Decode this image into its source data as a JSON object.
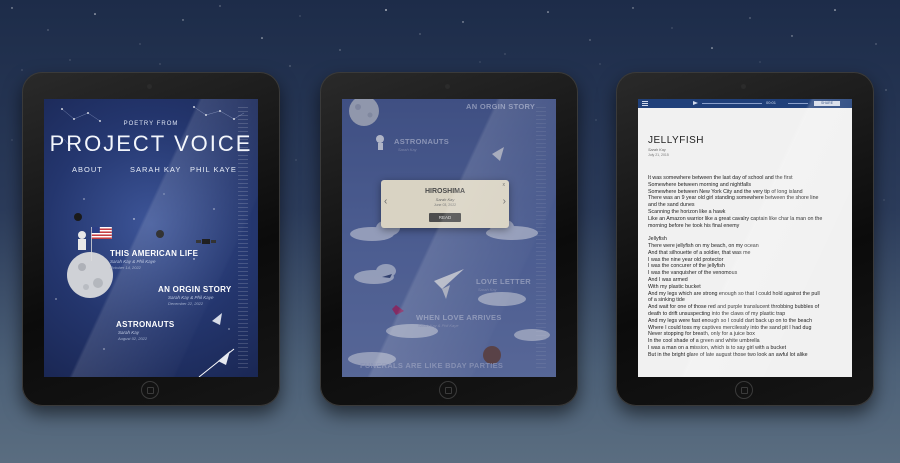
{
  "screen1": {
    "eyebrow": "POETRY FROM",
    "title": "PROJECT VOICE",
    "nav": [
      "ABOUT",
      "SARAH KAY",
      "PHIL KAYE"
    ],
    "poems": [
      {
        "title": "THIS AMERICAN LIFE",
        "authors": "Sarah Kay & Phil Kaye",
        "date": "October 14, 2022"
      },
      {
        "title": "AN ORGIN STORY",
        "authors": "Sarah Kay & Phil Kaye",
        "date": "December 22, 2022"
      },
      {
        "title": "ASTRONAUTS",
        "authors": "Sarah Kay",
        "date": "August 02, 2022"
      }
    ]
  },
  "screen2": {
    "items": [
      {
        "title": "AN ORGIN STORY",
        "sub": "Sarah Kay & Phil Kaye"
      },
      {
        "title": "ASTRONAUTS",
        "sub": "Sarah Kay"
      },
      {
        "title": "LOVE LETTER",
        "sub": "Sarah Kay"
      },
      {
        "title": "WHEN LOVE ARRIVES",
        "sub": "Sarah Kay & Phil Kaye"
      },
      {
        "title": "FUNERALS ARE LIKE BDAY PARTIES",
        "sub": ""
      }
    ],
    "modal": {
      "title": "HIROSHIMA",
      "author": "Sarah Kay",
      "date": "June 03, 2022",
      "button": "READ",
      "close": "x"
    }
  },
  "screen3": {
    "player": {
      "time": "00:01",
      "share": "SHARE"
    },
    "title": "JELLYFISH",
    "author": "Sarah Kay",
    "date": "July 21, 2015",
    "lines": [
      "It was somewhere between the last day of school and the first",
      "Somewhere between morning and nightfalls",
      "Somewhere between New York City and the very tip of long island",
      "There was an 9 year old girl standing somewhere between the shore line",
      "and the sand dunes",
      "Scanning the horizon like a hawk",
      "Like an Amazon warrior like a great cavalry captain like char la man on the",
      "morning before he took his final enemy",
      "",
      "Jellyfish",
      "There were jellyfish on my beach, on my ocean",
      "And that silhouette of a soldier, that was me",
      "I was the nine year old protector",
      "I was the concurer of the jellyfish",
      "I was the vanquisher of the venomous",
      "And I was armed",
      "With my plastic bucket",
      "And my legs which are strong enough so that I could hold against the pull",
      "of a sinking tide",
      "And wait for one of those red and purple translucent throbbing bubbles of",
      "death to drift unsuspecting into the claws of my plastic trap",
      "And my legs were fast enough so I could dart back up on to the beach",
      "Where I could toss my captives mercilessly into the sand pit I had dug",
      "Never stopping for breath, only for a juice box",
      "In the cool shade of a green and white umbrella",
      "I was a man on a mission, which is to say girl with a bucket",
      "But in the bright glare of late august those two look an awful lot alike"
    ]
  }
}
